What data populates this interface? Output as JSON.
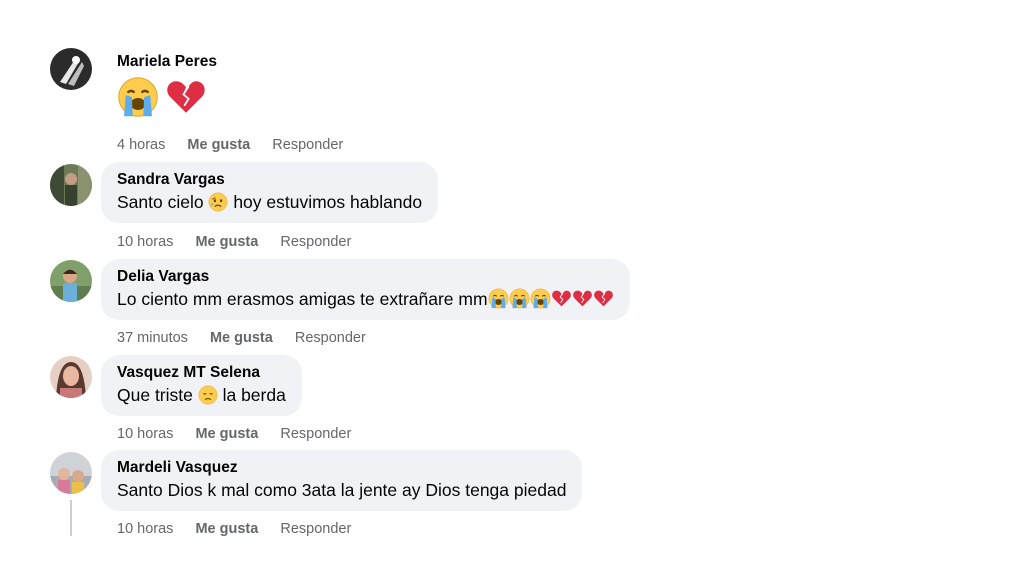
{
  "comments": [
    {
      "author": "Mariela Peres",
      "text": "",
      "time": "4 horas",
      "like": "Me gusta",
      "reply": "Responder"
    },
    {
      "author": "Sandra Vargas",
      "text_before": "Santo cielo ",
      "text_after": " hoy estuvimos hablando",
      "time": "10 horas",
      "like": "Me gusta",
      "reply": "Responder"
    },
    {
      "author": "Delia Vargas",
      "text": "Lo ciento mm erasmos amigas te extrañare mm",
      "time": "37 minutos",
      "like": "Me gusta",
      "reply": "Responder"
    },
    {
      "author": "Vasquez MT Selena",
      "text_before": "Que triste ",
      "text_after": " la berda",
      "time": "10 horas",
      "like": "Me gusta",
      "reply": "Responder"
    },
    {
      "author": "Mardeli Vasquez",
      "text": "Santo Dios k mal como 3ata la jente ay Dios tenga piedad",
      "time": "10 horas",
      "like": "Me gusta",
      "reply": "Responder"
    }
  ],
  "icons": {
    "crying": "loudly-crying-face-emoji",
    "broken_heart": "broken-heart-emoji",
    "sad": "sad-relieved-face-emoji",
    "disappointed": "disappointed-face-emoji"
  },
  "colors": {
    "bubble": "#f0f2f5",
    "meta": "#65676b",
    "text": "#050505"
  }
}
